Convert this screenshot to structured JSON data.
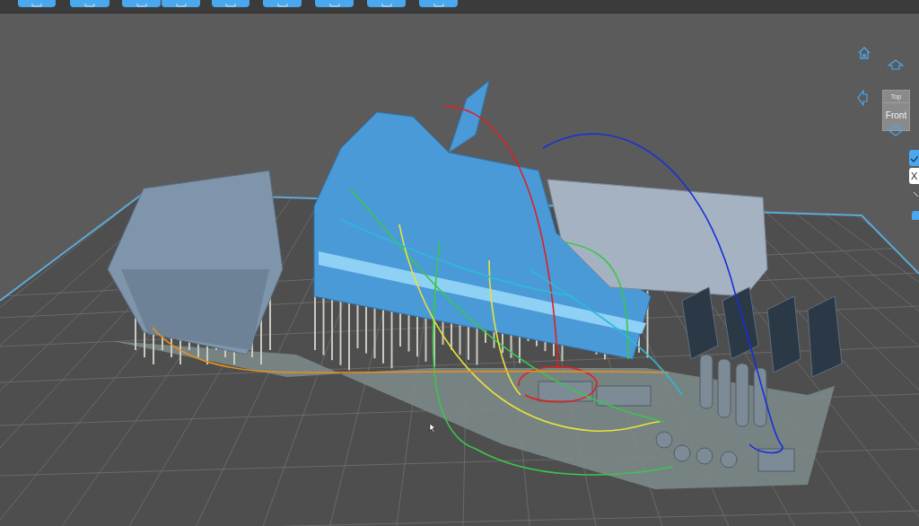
{
  "view_cube": {
    "top_label": "Top",
    "front_label": "Front"
  },
  "side_panel": {
    "close_label": "X"
  }
}
